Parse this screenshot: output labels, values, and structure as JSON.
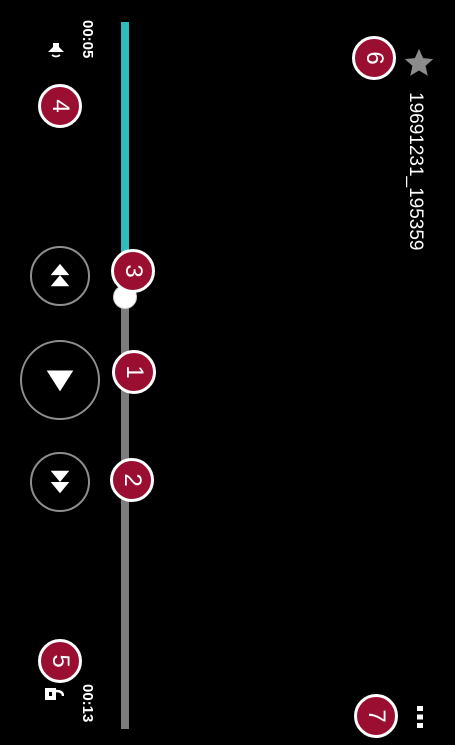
{
  "file": {
    "name": "19691231_195359"
  },
  "timeline": {
    "current_time": "00:05",
    "total_time": "00:13",
    "progress_fraction": 0.38
  },
  "icons": {
    "favorite": "star-icon",
    "more": "more-icon",
    "volume": "volume-icon",
    "lock": "lock-icon",
    "rewind": "rewind-icon",
    "play": "play-icon",
    "forward": "fast-forward-icon"
  },
  "colors": {
    "background": "#000000",
    "progress": "#2ebcbc",
    "track": "#7c7c7c",
    "callout": "#9a0e32"
  },
  "callouts": {
    "one": "1",
    "two": "2",
    "three": "3",
    "four": "4",
    "five": "5",
    "six": "6",
    "seven": "7"
  }
}
